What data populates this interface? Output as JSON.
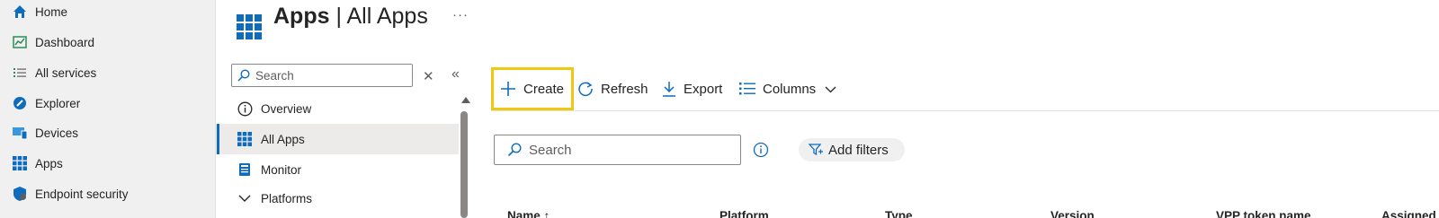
{
  "leftnav": {
    "items": [
      {
        "label": "Home",
        "icon": "home-icon"
      },
      {
        "label": "Dashboard",
        "icon": "dashboard-icon"
      },
      {
        "label": "All services",
        "icon": "list-icon"
      },
      {
        "label": "Explorer",
        "icon": "explorer-icon"
      },
      {
        "label": "Devices",
        "icon": "devices-icon"
      },
      {
        "label": "Apps",
        "icon": "apps-icon"
      },
      {
        "label": "Endpoint security",
        "icon": "shield-icon"
      }
    ]
  },
  "header": {
    "title_bold": "Apps",
    "title_rest": " | All Apps",
    "more": "···"
  },
  "resource_menu": {
    "search_placeholder": "Search",
    "items": [
      {
        "label": "Overview",
        "icon": "info-icon"
      },
      {
        "label": "All Apps",
        "icon": "apps-grid-icon",
        "active": true
      },
      {
        "label": "Monitor",
        "icon": "monitor-icon"
      },
      {
        "label": "Platforms",
        "icon": "chevron-down-icon"
      }
    ]
  },
  "toolbar": {
    "create_label": "Create",
    "refresh_label": "Refresh",
    "export_label": "Export",
    "columns_label": "Columns"
  },
  "filters": {
    "search_placeholder": "Search",
    "add_filters_label": "Add filters"
  },
  "table": {
    "columns": [
      "Name ↑",
      "Platform",
      "Type",
      "Version",
      "VPP token name",
      "Assigned"
    ]
  },
  "colors": {
    "accent": "#0f6cbd",
    "highlight": "#f2c80f",
    "nav_bg": "#f0f0f0"
  }
}
